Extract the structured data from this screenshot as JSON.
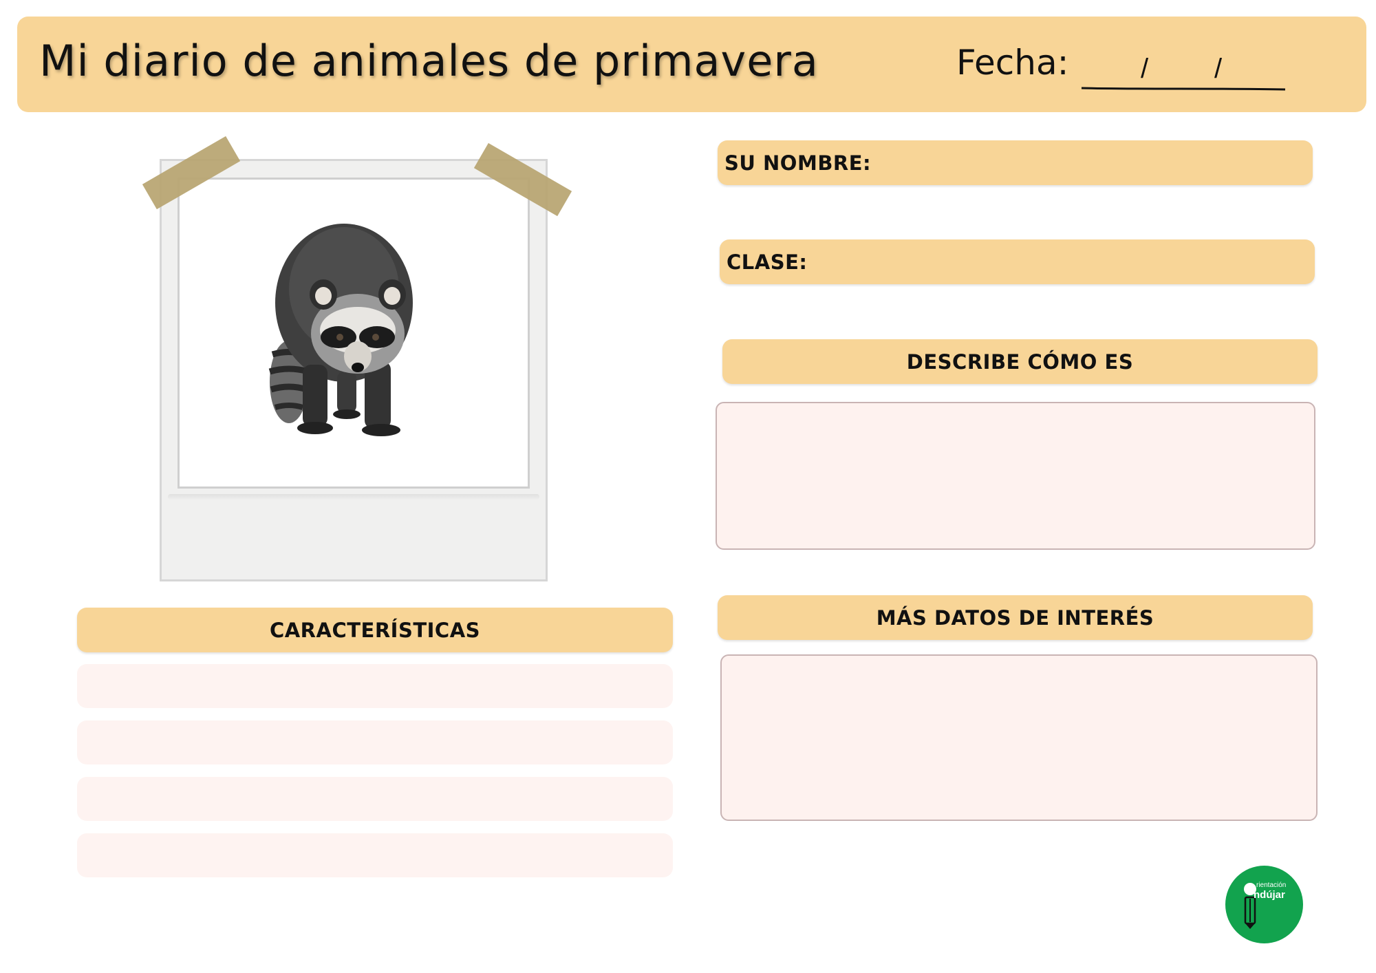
{
  "colors": {
    "header_bg": "#f8d597",
    "pill_bg": "#f8d597",
    "box_bg": "#fef2ef",
    "line_bg": "#fef3f1",
    "logo_bg": "#12a34e"
  },
  "header": {
    "title": "Mi diario de animales de primavera",
    "date_label": "Fecha:",
    "date_separator": "/"
  },
  "photo": {
    "subject_icon": "raccoon-icon"
  },
  "fields": {
    "name_label": "SU NOMBRE:",
    "class_label": "CLASE:"
  },
  "sections": {
    "describe": "DESCRIBE CÓMO ES",
    "more_data": "MÁS DATOS DE INTERÉS",
    "characteristics": "CARACTERÍSTICAS"
  },
  "logo": {
    "line1": "rientación",
    "line2": "ndújar"
  }
}
